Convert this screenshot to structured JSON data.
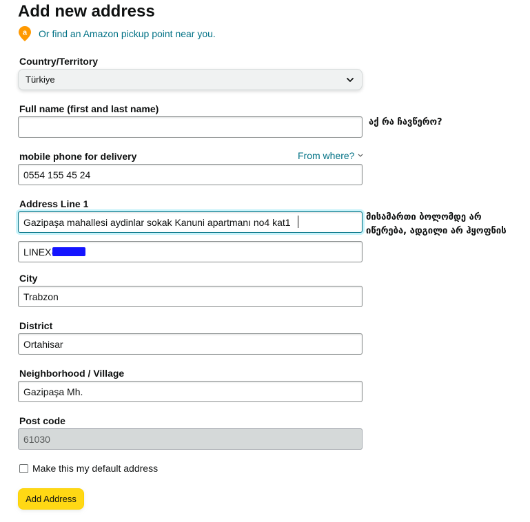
{
  "page": {
    "title": "Add new address"
  },
  "pickup": {
    "link_text": "Or find an Amazon pickup point near you.",
    "icon": "amazon-pin-icon"
  },
  "form": {
    "country": {
      "label": "Country/Territory",
      "value": "Türkiye"
    },
    "full_name": {
      "label": "Full name (first and last name)",
      "value": ""
    },
    "phone": {
      "label": "mobile phone for delivery",
      "value": "0554 155 45 24",
      "help_link": "From where?"
    },
    "address_line1": {
      "label": "Address Line 1",
      "value": "Gazipaşa mahallesi aydinlar sokak Kanuni apartmanı no4 kat1"
    },
    "address_line2": {
      "value": "LINEX-"
    },
    "city": {
      "label": "City",
      "value": "Trabzon"
    },
    "district": {
      "label": "District",
      "value": "Ortahisar"
    },
    "neighborhood": {
      "label": "Neighborhood / Village",
      "value": "Gazipaşa Mh."
    },
    "post_code": {
      "label": "Post code",
      "value": "61030"
    },
    "default_checkbox": {
      "label": "Make this my default address",
      "checked": false
    },
    "submit_label": "Add Address"
  },
  "annotations": {
    "name_note": "აქ რა ჩავწერო?",
    "address_note_line1": "მისამართი ბოლომდე არ",
    "address_note_line2": "იწერება, ადგილი არ ჰყოფნის"
  },
  "colors": {
    "link": "#007185",
    "button": "#ffd814",
    "focus": "#007185",
    "redaction": "#1414ff"
  }
}
